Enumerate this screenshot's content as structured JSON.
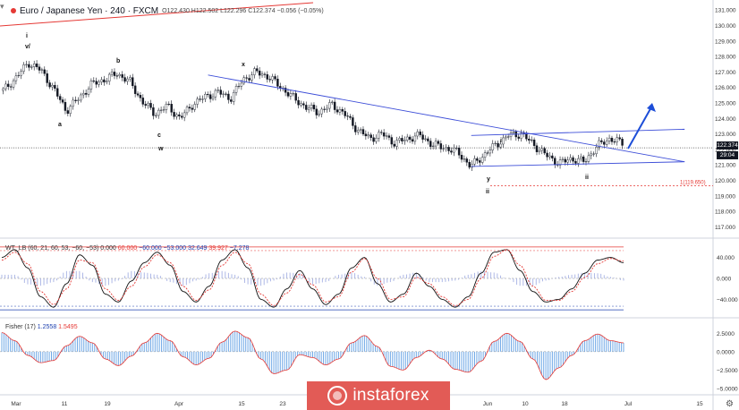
{
  "header": {
    "title": "Euro / Japanese Yen · 240 · FXCM",
    "ohlc": "O122.430  H122.502  L122.296  C122.374  −0.056 (−0.05%)",
    "status_color": "#e53935"
  },
  "price_panel": {
    "y_ticks": [
      "131.000",
      "130.000",
      "129.000",
      "128.000",
      "127.000",
      "126.000",
      "125.000",
      "124.000",
      "123.000",
      "122.000",
      "121.000",
      "120.000",
      "119.000",
      "118.000",
      "117.000"
    ],
    "last_price": "122.374",
    "countdown": "29:04",
    "target_label": "1(119.650)",
    "target_value": 119.65,
    "wave_labels": {
      "i_top": "i",
      "v": "v/",
      "b": "b",
      "x": "x",
      "a": "a",
      "c": "c",
      "w": "w",
      "i_mid": "i",
      "y": "y",
      "ii": "ii",
      "ii_bottom": "ii"
    },
    "colors": {
      "candle": "#131722",
      "trendline": "#3d4ed8",
      "arrow": "#1d4ed8",
      "red_line": "#e53935"
    }
  },
  "wt_panel": {
    "label": "WT_LB",
    "params": "(60, 21, 60, 53, −60, −53)",
    "values": [
      "0.000",
      "60.000",
      "−60.000",
      "−53.000",
      "32.649",
      "39.927",
      "−7.278"
    ],
    "y_ticks": [
      "40.000",
      "0.000",
      "−40.000"
    ]
  },
  "fisher_panel": {
    "label": "Fisher (17)",
    "values": [
      "1.2558",
      "1.5495"
    ],
    "y_ticks": [
      "2.5000",
      "0.0000",
      "−2.5000",
      "−5.0000"
    ]
  },
  "x_axis": {
    "ticks": [
      "Mar",
      "11",
      "19",
      "Apr",
      "15",
      "23",
      "Jun",
      "10",
      "18",
      "Jul",
      "15"
    ]
  },
  "watermark": {
    "text": "instaforex"
  },
  "chart_data": [
    {
      "type": "line",
      "title": "Euro / Japanese Yen · 240 · FXCM",
      "x_ticks": [
        "Mar",
        "11",
        "19",
        "Apr",
        "15",
        "23",
        "Jun",
        "10",
        "18",
        "Jul",
        "15"
      ],
      "ylim": [
        116.5,
        131.3
      ],
      "series": [
        {
          "name": "EUR/JPY",
          "values": [
            125.8,
            126.6,
            127.6,
            127.1,
            125.9,
            124.5,
            125.3,
            126.2,
            126.5,
            126.9,
            126.4,
            125.1,
            124.3,
            124.8,
            124.0,
            124.9,
            125.4,
            125.7,
            125.3,
            126.5,
            127.0,
            126.7,
            126.0,
            125.3,
            124.7,
            124.4,
            124.9,
            124.3,
            123.3,
            122.7,
            123.0,
            122.4,
            122.7,
            122.9,
            122.3,
            122.1,
            121.8,
            120.9,
            121.6,
            122.3,
            122.9,
            123.0,
            122.3,
            121.6,
            121.1,
            121.4,
            121.2,
            122.2,
            122.7,
            122.4
          ]
        }
      ],
      "annotations": [
        {
          "type": "trendline",
          "from": [
            0.29,
            126.8
          ],
          "to": [
            0.96,
            121.2
          ]
        },
        {
          "type": "trendline",
          "from": [
            0.66,
            122.9
          ],
          "to": [
            0.96,
            123.3
          ]
        },
        {
          "type": "trendline",
          "from": [
            0.66,
            120.9
          ],
          "to": [
            0.96,
            121.2
          ]
        },
        {
          "type": "hline",
          "value": 122.1,
          "style": "dotted"
        },
        {
          "type": "target",
          "value": 119.65,
          "label": "1(119.650)"
        }
      ]
    },
    {
      "type": "line",
      "title": "WT_LB (60, 21, 60, 53, −60, −53)",
      "ylim": [
        -70,
        70
      ],
      "series": [
        {
          "name": "WT1",
          "values": [
            40,
            55,
            20,
            -35,
            -55,
            -10,
            45,
            25,
            -30,
            -45,
            -5,
            30,
            50,
            25,
            -25,
            -45,
            -15,
            35,
            55,
            20,
            -40,
            -55,
            -20,
            15,
            -20,
            -50,
            -30,
            20,
            40,
            -10,
            -45,
            -30,
            10,
            -15,
            -40,
            -55,
            -35,
            10,
            50,
            55,
            15,
            -25,
            -45,
            -40,
            -20,
            10,
            35,
            40,
            30
          ]
        },
        {
          "name": "WT2",
          "values": [
            35,
            50,
            28,
            -25,
            -50,
            -20,
            35,
            30,
            -20,
            -42,
            -15,
            22,
            45,
            30,
            -15,
            -42,
            -22,
            25,
            50,
            28,
            -30,
            -52,
            -28,
            8,
            -12,
            -45,
            -35,
            12,
            38,
            0,
            -40,
            -35,
            2,
            -10,
            -35,
            -52,
            -40,
            0,
            42,
            55,
            25,
            -15,
            -42,
            -42,
            -25,
            2,
            28,
            38,
            33
          ]
        }
      ]
    },
    {
      "type": "bar",
      "title": "Fisher (17)",
      "ylim": [
        -5.5,
        4.0
      ],
      "series": [
        {
          "name": "Fisher",
          "values": [
            2.6,
            1.5,
            -0.5,
            -1.5,
            -1.2,
            0.8,
            2.1,
            1.2,
            -1.0,
            -1.9,
            -0.6,
            1.2,
            2.5,
            1.5,
            -0.7,
            -1.8,
            -0.9,
            1.3,
            2.8,
            1.9,
            -1.0,
            -3.0,
            -2.5,
            -0.4,
            -0.8,
            -1.8,
            -1.0,
            1.2,
            2.2,
            0.7,
            -2.0,
            -2.5,
            -0.8,
            0.2,
            -1.0,
            -2.4,
            -2.8,
            -1.3,
            1.4,
            2.5,
            1.4,
            -1.0,
            -3.8,
            -2.2,
            -0.5,
            1.5,
            2.4,
            1.5,
            1.2
          ]
        }
      ]
    }
  ]
}
